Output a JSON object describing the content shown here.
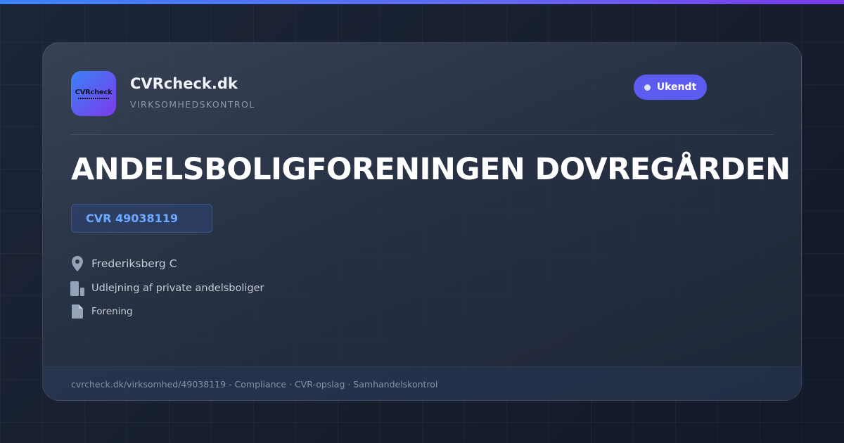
{
  "brand": {
    "name": "CVRcheck.dk",
    "subtitle": "VIRKSOMHEDSKONTROL",
    "logo_text": "CVRcheck",
    "accent_gradient": [
      "#3b82f6",
      "#7c3aed"
    ]
  },
  "status": {
    "label": "Ukendt",
    "color": "#5b5bf0"
  },
  "company": {
    "name": "ANDELSBOLIGFORENINGEN DOVREGÅRDEN",
    "cvr_label": "CVR 49038119"
  },
  "details": [
    {
      "icon": "location-pin-icon",
      "text": "Frederiksberg C"
    },
    {
      "icon": "buildings-icon",
      "text": "Udlejning af private andelsboliger"
    },
    {
      "icon": "document-icon",
      "text": "Forening"
    }
  ],
  "footer": {
    "text": "cvrcheck.dk/virksomhed/49038119 - Compliance · CVR-opslag · Samhandelskontrol"
  }
}
